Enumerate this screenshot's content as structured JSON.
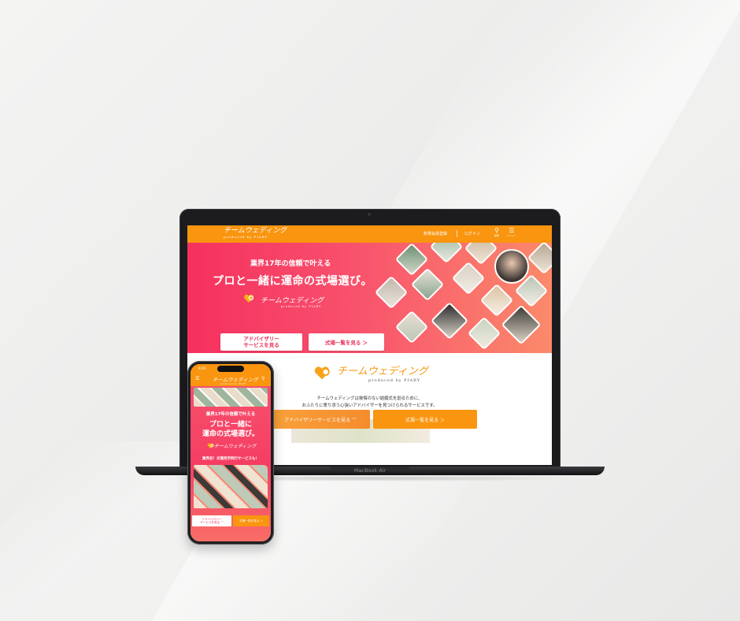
{
  "laptop": {
    "model_label": "MacBook Air",
    "site": {
      "brand": "チームウェディング",
      "brand_sub": "produced by PIARY",
      "nav": {
        "register": "新規会員登録",
        "login": "ログイン",
        "search_label": "検索",
        "menu_label": "メニュー"
      },
      "hero": {
        "subtitle": "業界17年の信頼で叶える",
        "title": "プロと一緒に運命の式場選び。",
        "logo": "チームウェディング",
        "logo_sub": "produced by PIARY",
        "advisor_button": "アドバイザリー\nサービスを見る",
        "venues_button": "式場一覧を見る ＞"
      },
      "intro": {
        "logo": "チームウェディング",
        "logo_sub": "produced by PIARY",
        "line1": "チームウェディングは後悔のない結婚式を創るために、",
        "line2": "おふたりに寄り添う心強いアドバイザーを見つけられるサービスです。",
        "advisor_button": "アドバイザリーサービスを見る ﹀",
        "venues_button": "式場一覧を見る ＞"
      }
    }
  },
  "phone": {
    "status_time": "9:29",
    "brand": "チームウェディング",
    "brand_sub": "produced by PIARY",
    "hero": {
      "subtitle": "業界17年の信頼で叶える",
      "title_line1": "プロと一緒に",
      "title_line2": "運命の式場選び。",
      "logo": "チームウェディング",
      "tagline": "業界初！式場見学同行サービスも！",
      "advisor_button": "アドバイザリー\nサービスを見る ﹀",
      "venues_button": "式場一覧を見る ＞"
    }
  },
  "colors": {
    "orange": "#f9950f",
    "pink": "#f5305e",
    "coral": "#fb8a6a"
  }
}
